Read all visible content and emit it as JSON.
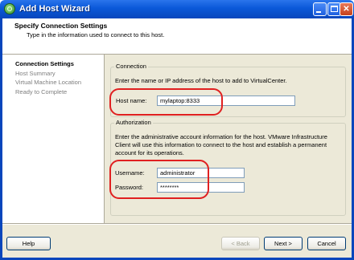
{
  "window": {
    "title": "Add Host Wizard"
  },
  "header": {
    "title": "Specify Connection Settings",
    "subtitle": "Type in the information used to connect to this host."
  },
  "steps": [
    {
      "label": "Connection Settings"
    },
    {
      "label": "Host Summary"
    },
    {
      "label": "Virtual Machine Location"
    },
    {
      "label": "Ready to Complete"
    }
  ],
  "connection": {
    "group_label": "Connection",
    "instructions": "Enter the name or IP address of the host to add to VirtualCenter.",
    "host_label": "Host name:",
    "host_value": "mylaptop:8333"
  },
  "authorization": {
    "group_label": "Authorization",
    "instructions_1": "Enter the administrative account information for the host. VMware Infrastructure",
    "instructions_2": "Client will use this information to connect to the host and establish a permanent",
    "instructions_3": "account for its operations.",
    "username_label": "Username:",
    "username_value": "administrator",
    "password_label": "Password:",
    "password_value": "********"
  },
  "buttons": {
    "help": "Help",
    "back": "< Back",
    "next": "Next >",
    "cancel": "Cancel"
  },
  "colors": {
    "annotation": "#e02020",
    "titlebar": "#0a58d8"
  }
}
